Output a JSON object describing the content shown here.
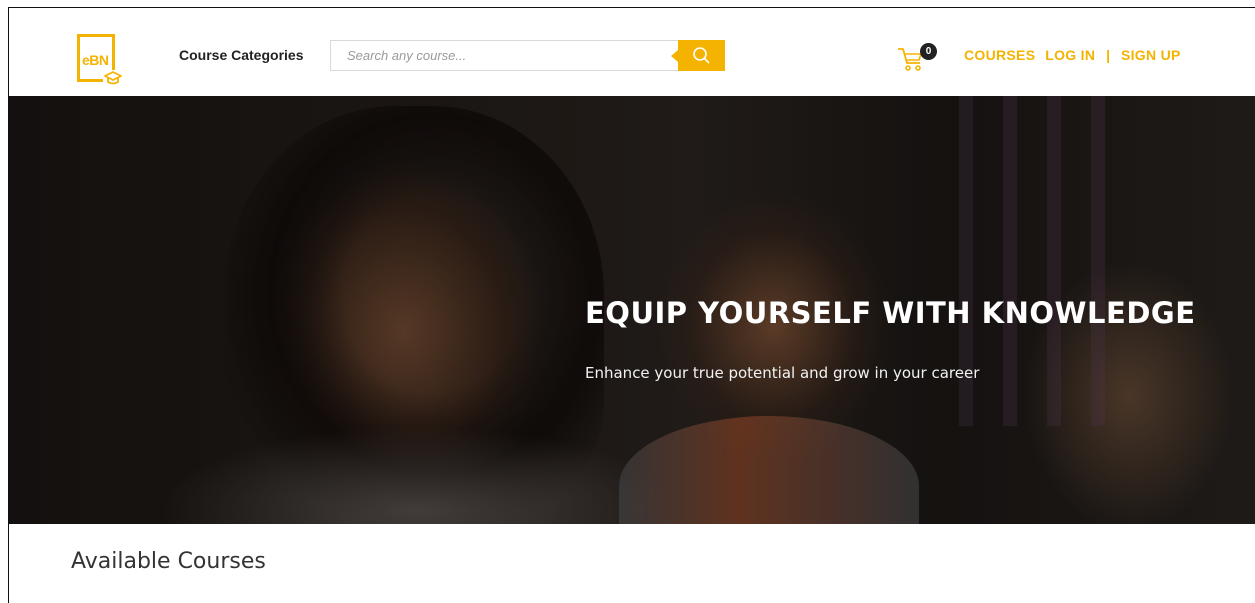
{
  "header": {
    "logo_text": "eBN",
    "categories_label": "Course Categories",
    "search": {
      "placeholder": "Search any course...",
      "value": ""
    },
    "cart": {
      "count": "0"
    },
    "nav": {
      "courses": "COURSES",
      "login": "LOG IN",
      "separator": "|",
      "signup": "SIGN UP"
    }
  },
  "hero": {
    "title": "EQUIP YOURSELF WITH KNOWLEDGE",
    "subtitle": "Enhance your true potential and grow in your career"
  },
  "main": {
    "section_title": "Available Courses"
  },
  "colors": {
    "accent": "#f5b301",
    "text_dark": "#222222"
  },
  "icons": [
    "logo-graduation-cap-icon",
    "search-icon",
    "cart-icon"
  ]
}
